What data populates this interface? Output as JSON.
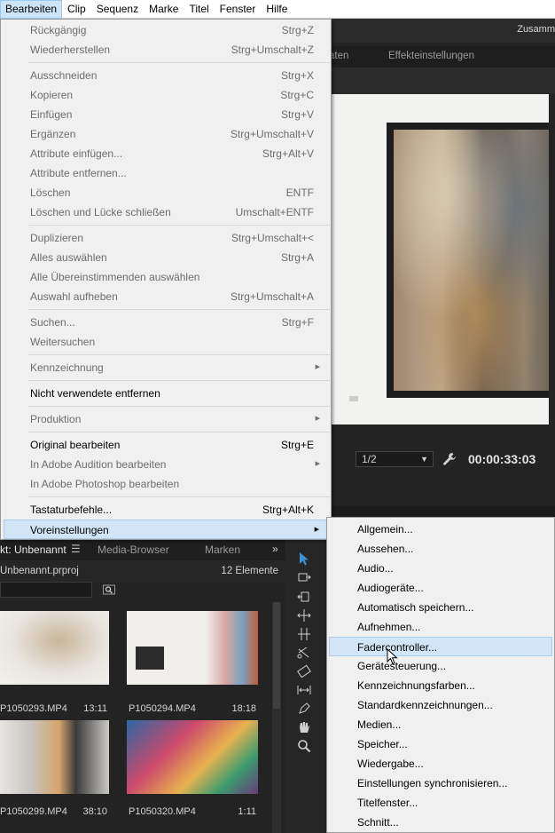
{
  "menubar": [
    "Bearbeiten",
    "Clip",
    "Sequenz",
    "Marke",
    "Titel",
    "Fenster",
    "Hilfe"
  ],
  "workspace_label": "Zusamm",
  "monitor_tabs": {
    "partial": "aten",
    "effekt": "Effekteinstellungen"
  },
  "monitor": {
    "fraction": "1/2",
    "timecode": "00:00:33:03"
  },
  "project": {
    "tab_project": "kt: Unbenannt",
    "tab_media": "Media-Browser",
    "tab_marker": "Marken",
    "filename": "Unbenannt.prproj",
    "count": "12 Elemente",
    "items": [
      {
        "name": "P1050293.MP4",
        "dur": "13:11"
      },
      {
        "name": "P1050294.MP4",
        "dur": "18:18"
      },
      {
        "name": "P1050299.MP4",
        "dur": "38:10"
      },
      {
        "name": "P1050320.MP4",
        "dur": "1:11"
      }
    ]
  },
  "menu": [
    {
      "label": "Rückgängig",
      "shortcut": "Strg+Z"
    },
    {
      "label": "Wiederherstellen",
      "shortcut": "Strg+Umschalt+Z"
    },
    {
      "label": "Ausschneiden",
      "shortcut": "Strg+X"
    },
    {
      "label": "Kopieren",
      "shortcut": "Strg+C"
    },
    {
      "label": "Einfügen",
      "shortcut": "Strg+V"
    },
    {
      "label": "Ergänzen",
      "shortcut": "Strg+Umschalt+V"
    },
    {
      "label": "Attribute einfügen...",
      "shortcut": "Strg+Alt+V"
    },
    {
      "label": "Attribute entfernen...",
      "shortcut": ""
    },
    {
      "label": "Löschen",
      "shortcut": "ENTF"
    },
    {
      "label": "Löschen und Lücke schließen",
      "shortcut": "Umschalt+ENTF"
    },
    {
      "label": "Duplizieren",
      "shortcut": "Strg+Umschalt+<"
    },
    {
      "label": "Alles auswählen",
      "shortcut": "Strg+A"
    },
    {
      "label": "Alle Übereinstimmenden auswählen",
      "shortcut": ""
    },
    {
      "label": "Auswahl aufheben",
      "shortcut": "Strg+Umschalt+A"
    },
    {
      "label": "Suchen...",
      "shortcut": "Strg+F"
    },
    {
      "label": "Weitersuchen",
      "shortcut": ""
    },
    {
      "label": "Kennzeichnung",
      "shortcut": ""
    },
    {
      "label": "Nicht verwendete entfernen",
      "shortcut": ""
    },
    {
      "label": "Produktion",
      "shortcut": ""
    },
    {
      "label": "Original bearbeiten",
      "shortcut": "Strg+E"
    },
    {
      "label": "In Adobe Audition bearbeiten",
      "shortcut": ""
    },
    {
      "label": "In Adobe Photoshop bearbeiten",
      "shortcut": ""
    },
    {
      "label": "Tastaturbefehle...",
      "shortcut": "Strg+Alt+K"
    },
    {
      "label": "Voreinstellungen",
      "shortcut": ""
    }
  ],
  "submenu": [
    "Allgemein...",
    "Aussehen...",
    "Audio...",
    "Audiogeräte...",
    "Automatisch speichern...",
    "Aufnehmen...",
    "Fadercontroller...",
    "Gerätesteuerung...",
    "Kennzeichnungsfarben...",
    "Standardkennzeichnungen...",
    "Medien...",
    "Speicher...",
    "Wiedergabe...",
    "Einstellungen synchronisieren...",
    "Titelfenster...",
    "Schnitt..."
  ],
  "colors": {
    "highlight": "#d1e5f6",
    "highlight_border": "#a7ccec",
    "disabled_text": "#6d6d6d",
    "tool_accent": "#3d8fd6"
  }
}
